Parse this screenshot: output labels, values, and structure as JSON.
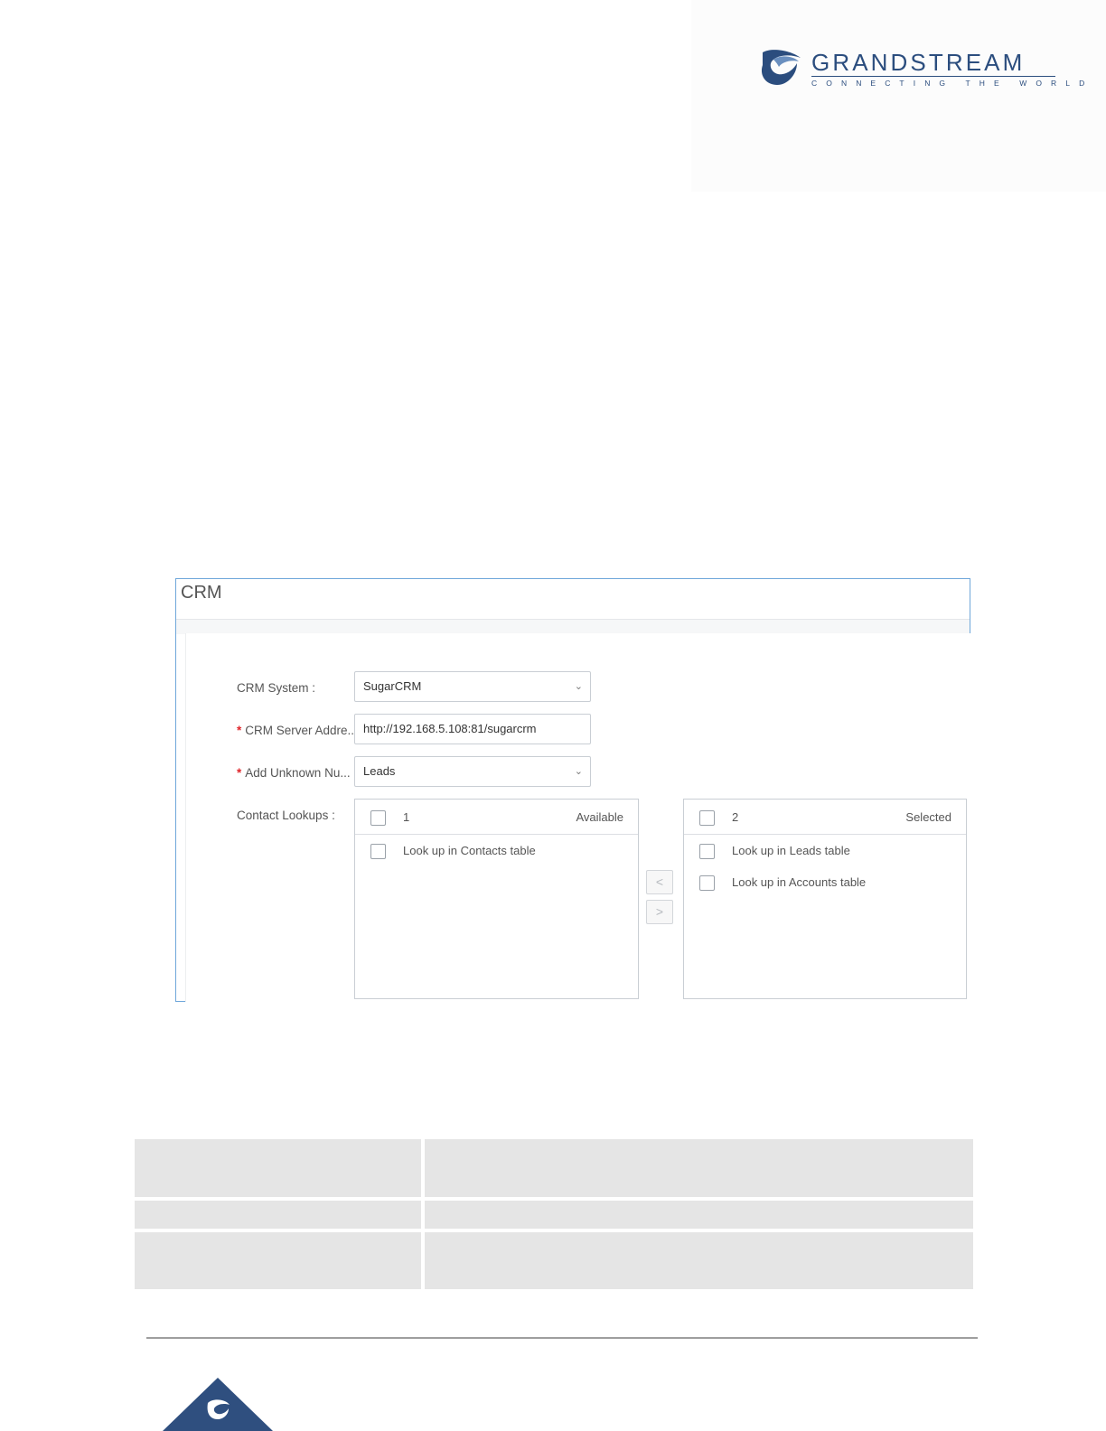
{
  "brand": {
    "name": "GRANDSTREAM",
    "tagline": "CONNECTING THE WORLD",
    "primary_color": "#2b4d7e",
    "logo_icon": "grandstream-swirl-icon"
  },
  "panel": {
    "title": "CRM",
    "crm_system": {
      "label": "CRM System",
      "value": "SugarCRM"
    },
    "server_address": {
      "label": "CRM Server Addre...",
      "value": "http://192.168.5.108:81/sugarcrm",
      "required": true
    },
    "add_unknown": {
      "label": "Add Unknown Nu...",
      "value": "Leads",
      "required": true
    },
    "contact_lookups": {
      "label": "Contact Lookups",
      "available": {
        "count": "1",
        "title": "Available",
        "items": [
          "Look up in Contacts table"
        ]
      },
      "selected": {
        "count": "2",
        "title": "Selected",
        "items": [
          "Look up in Leads table",
          "Look up in Accounts table"
        ]
      },
      "move_left": "<",
      "move_right": ">"
    },
    "required_marker": "*",
    "label_separator": ":"
  },
  "footer": {
    "logo_icon": "grandstream-swirl-icon"
  }
}
